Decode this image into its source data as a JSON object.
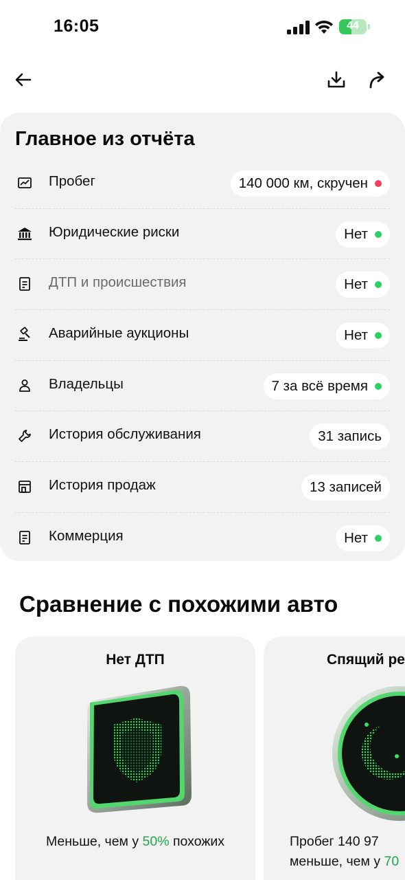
{
  "status_bar": {
    "time": "16:05",
    "battery_level": "44",
    "battery_fraction": 0.44
  },
  "topbar": {
    "back_icon": "arrow-left-icon",
    "download_icon": "download-icon",
    "share_icon": "share-arrow-icon"
  },
  "summary": {
    "title": "Главное из отчёта",
    "rows": [
      {
        "icon": "mileage-chart-icon",
        "label": "Пробег",
        "value": "140 000 км, скручен",
        "status": "red",
        "muted": false
      },
      {
        "icon": "bank-icon",
        "label": "Юридические риски",
        "value": "Нет",
        "status": "green",
        "muted": false
      },
      {
        "icon": "document-icon",
        "label": "ДТП и происшествия",
        "value": "Нет",
        "status": "green",
        "muted": true
      },
      {
        "icon": "gavel-icon",
        "label": "Аварийные аукционы",
        "value": "Нет",
        "status": "green",
        "muted": false
      },
      {
        "icon": "person-icon",
        "label": "Владельцы",
        "value": "7 за всё время",
        "status": "green",
        "muted": false
      },
      {
        "icon": "wrench-icon",
        "label": "История обслуживания",
        "value": "31 запись",
        "status": "none",
        "muted": false
      },
      {
        "icon": "shop-icon",
        "label": "История продаж",
        "value": "13 записей",
        "status": "none",
        "muted": false
      },
      {
        "icon": "document-icon",
        "label": "Коммерция",
        "value": "Нет",
        "status": "green",
        "muted": false
      }
    ]
  },
  "comparison": {
    "title": "Сравнение с похожими авто",
    "cards": [
      {
        "title": "Нет ДТП",
        "image_icon": "shield-badge-icon",
        "desc_prefix": "Меньше, чем у ",
        "desc_accent": "50%",
        "desc_suffix": " похожих"
      },
      {
        "title": "Спящий ре",
        "image_icon": "moon-badge-icon",
        "line1": "Пробег 140 97",
        "line2_prefix": "меньше, чем у ",
        "line2_accent": "70"
      }
    ]
  },
  "colors": {
    "accent_green": "#2dd163",
    "alert_red": "#f2405a",
    "card_bg": "#f2f2f2",
    "accent_text_green": "#1fa84b"
  }
}
